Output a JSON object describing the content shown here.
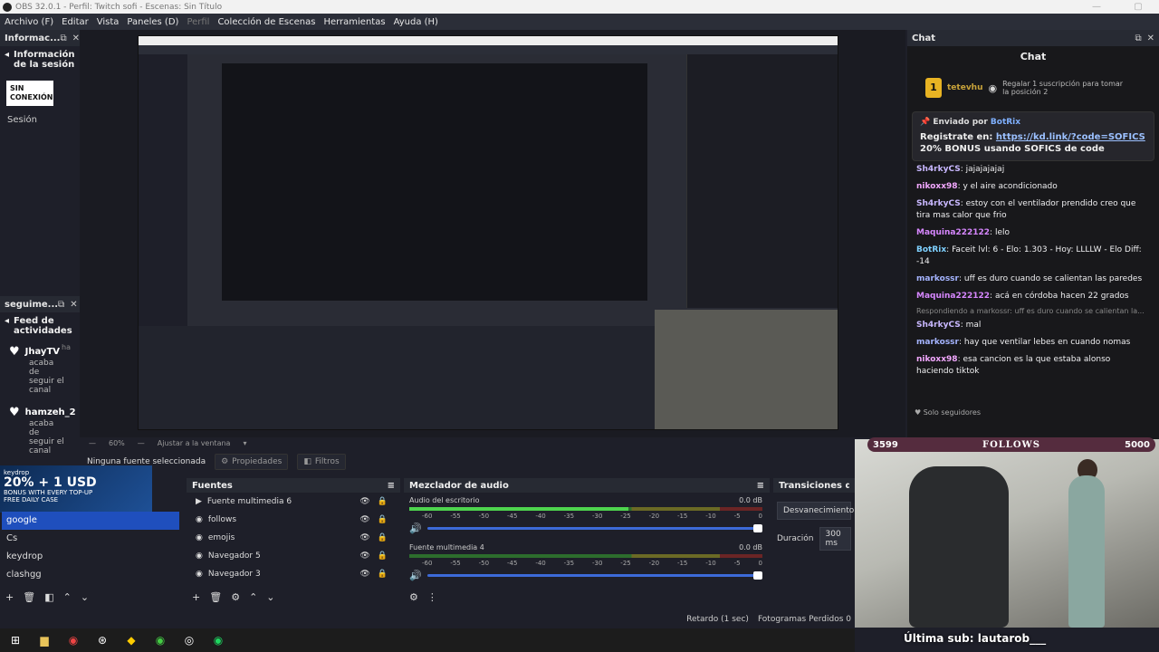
{
  "window": {
    "title": "OBS 32.0.1 - Perfil: Twitch sofi - Escenas: Sin Título"
  },
  "menu": [
    {
      "label": "Archivo (F)",
      "dim": false
    },
    {
      "label": "Editar",
      "dim": false
    },
    {
      "label": "Vista",
      "dim": false
    },
    {
      "label": "Paneles (D)",
      "dim": false
    },
    {
      "label": "Perfil",
      "dim": true
    },
    {
      "label": "Colección de Escenas",
      "dim": false
    },
    {
      "label": "Herramientas",
      "dim": false
    },
    {
      "label": "Ayuda (H)",
      "dim": false
    }
  ],
  "info_dock": {
    "title": "Informac...",
    "heading": "Información de la sesión",
    "badge": "SIN CONEXIÓN",
    "session_label": "Sesión"
  },
  "feed_dock": {
    "title": "seguime...",
    "heading": "Feed de actividades",
    "items": [
      {
        "user": "JhayTV",
        "ago": "ha",
        "desc": "acaba de seguir el canal"
      },
      {
        "user": "hamzeh_2",
        "ago": "",
        "desc": "acaba de seguir el canal"
      }
    ]
  },
  "zoom": {
    "level": "60%",
    "fit": "Ajustar a la ventana"
  },
  "source_toolbar": {
    "no_source": "Ninguna fuente seleccionada",
    "properties": "Propiedades",
    "filters": "Filtros"
  },
  "scenes": {
    "banner_main": "20% + 1 USD",
    "banner_sub": "BONUS WITH EVERY TOP-UP",
    "banner_daily": "FREE DAILY CASE",
    "banner_brand": "keydrop",
    "items": [
      "google",
      "Cs",
      "keydrop",
      "clashgg"
    ],
    "selected": 0
  },
  "sources": {
    "title": "Fuentes",
    "items": [
      "Fuente multimedia 6",
      "follows",
      "emojis",
      "Navegador 5",
      "Navegador 3"
    ]
  },
  "mixer": {
    "title": "Mezclador de audio",
    "tracks": [
      {
        "name": "Audio del escritorio",
        "db": "0.0 dB",
        "level": 0.62
      },
      {
        "name": "Fuente multimedia 4",
        "db": "0.0 dB",
        "level": 0
      }
    ],
    "scale": [
      "-60",
      "-55",
      "-50",
      "-45",
      "-40",
      "-35",
      "-30",
      "-25",
      "-20",
      "-15",
      "-10",
      "-5",
      "0"
    ]
  },
  "transitions": {
    "title": "Transiciones de esc",
    "selected": "Desvanecimiento",
    "duration_label": "Duración",
    "duration": "300 ms"
  },
  "status": {
    "delay": "Retardo (1 sec)",
    "frames": "Fotogramas Perdidos 0"
  },
  "chat": {
    "title": "Chat",
    "label": "Chat",
    "sub_card": {
      "user": "tetevhu",
      "count": "1",
      "msg": "Regalar 1 suscripción para tomar la posición 2"
    },
    "pinned": {
      "sent_by": "Enviado por",
      "bot": "BotRix",
      "body_prefix": "Registrate en:",
      "link": "https://kd.link/?code=SOFICS",
      "body_suffix": "20% BONUS usando SOFICS de code"
    },
    "messages": [
      {
        "user": "Sh4rkyCS",
        "color": "#c9b8ff",
        "text": "jajajajajaj"
      },
      {
        "user": "nikoxx98",
        "color": "#f3a8ff",
        "text": "y el aire acondicionado"
      },
      {
        "user": "Sh4rkyCS",
        "color": "#c9b8ff",
        "text": "estoy con el ventilador prendido creo que tira mas calor que frio"
      },
      {
        "user": "Maquina222122",
        "color": "#d787ff",
        "text": "lelo"
      },
      {
        "user": "BotRix",
        "color": "#7fd1ff",
        "text": "Faceit lvl: 6 - Elo: 1.303 - Hoy: LLLLW - Elo Diff: -14"
      },
      {
        "user": "markossr",
        "color": "#a5b4ff",
        "text": "uff es duro cuando se calientan las paredes"
      },
      {
        "user": "Maquina222122",
        "color": "#d787ff",
        "text": "acá en córdoba hacen 22 grados"
      },
      {
        "user": "Sh4rkyCS",
        "color": "#c9b8ff",
        "text": "mal"
      },
      {
        "user": "markossr",
        "color": "#a5b4ff",
        "text": "hay que ventilar lebes en cuando nomas"
      },
      {
        "user": "nikoxx98",
        "color": "#f3a8ff",
        "text": "esa cancion es la que estaba alonso haciendo tiktok"
      }
    ],
    "reply": "Respondiendo a markossr: uff es duro cuando se calientan la...",
    "footer": "Solo seguidores"
  },
  "overlay": {
    "count_left": "3599",
    "label": "FOLLOWS",
    "count_right": "5000",
    "last_sub": "Última sub: lautarob___"
  }
}
